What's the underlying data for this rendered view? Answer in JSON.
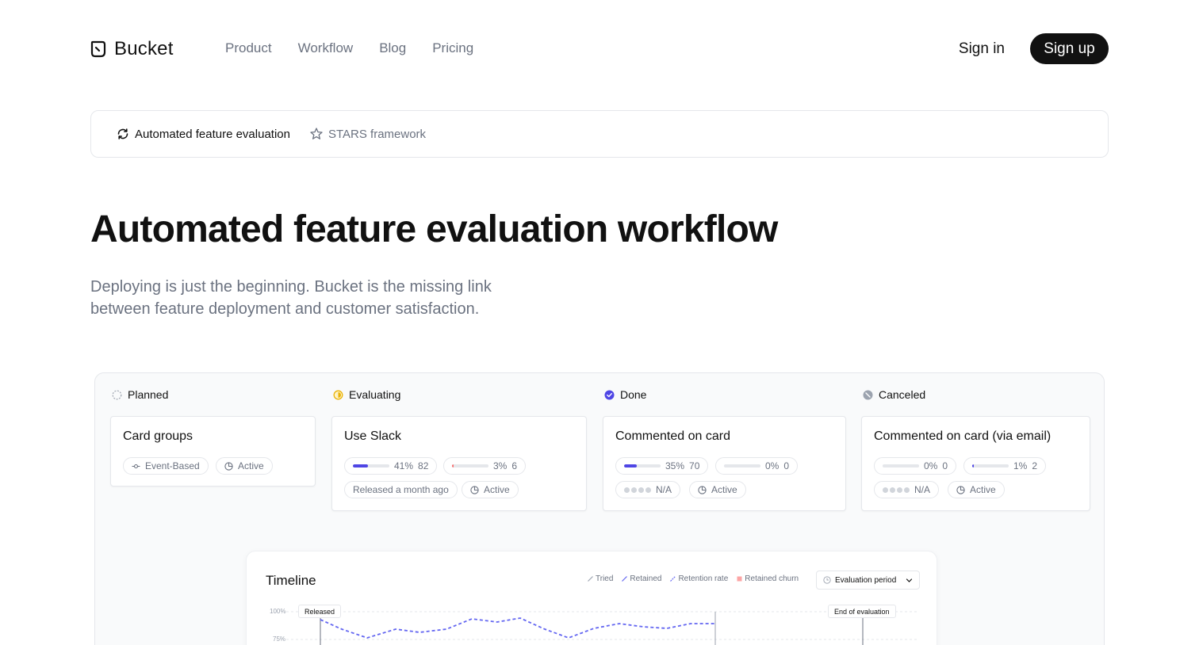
{
  "brand": {
    "name": "Bucket"
  },
  "nav": {
    "items": [
      "Product",
      "Workflow",
      "Blog",
      "Pricing"
    ]
  },
  "auth": {
    "signin": "Sign in",
    "signup": "Sign up"
  },
  "tabs": [
    {
      "label": "Automated feature evaluation",
      "icon": "refresh-icon",
      "active": true
    },
    {
      "label": "STARS framework",
      "icon": "star-icon",
      "active": false
    }
  ],
  "hero": {
    "title": "Automated feature evaluation workflow",
    "subtitle_line1": "Deploying is just the beginning. Bucket is the missing link",
    "subtitle_line2": "between feature deployment and customer satisfaction."
  },
  "board": {
    "columns": [
      {
        "label": "Planned",
        "icon": "dashed-circle-icon"
      },
      {
        "label": "Evaluating",
        "icon": "half-circle-icon",
        "color": "#eab308"
      },
      {
        "label": "Done",
        "icon": "check-circle-icon",
        "color": "#4f46e5"
      },
      {
        "label": "Canceled",
        "icon": "slash-circle-icon",
        "color": "#9ca3af"
      }
    ],
    "cards": {
      "card_groups": {
        "title": "Card groups",
        "type": "Event-Based",
        "status": "Active"
      },
      "use_slack": {
        "title": "Use Slack",
        "m1_pct": "41%",
        "m1_count": "82",
        "m1_fill": 0.41,
        "m2_pct": "3%",
        "m2_count": "6",
        "m2_fill": 0.03,
        "released": "Released a month ago",
        "status": "Active"
      },
      "commented": {
        "title": "Commented on card",
        "m1_pct": "35%",
        "m1_count": "70",
        "m1_fill": 0.35,
        "m2_pct": "0%",
        "m2_count": "0",
        "m2_fill": 0,
        "score": "N/A",
        "status": "Active"
      },
      "commented_email": {
        "title": "Commented on card (via email)",
        "m1_pct": "0%",
        "m1_count": "0",
        "m1_fill": 0,
        "m2_pct": "1%",
        "m2_count": "2",
        "m2_fill": 0.01,
        "score": "N/A",
        "status": "Active"
      }
    }
  },
  "timeline": {
    "title": "Timeline",
    "legend": [
      "Tried",
      "Retained",
      "Retention rate",
      "Retained churn"
    ],
    "select": "Evaluation period",
    "y_labels": [
      "100%",
      "75%"
    ],
    "markers": {
      "released": "Released",
      "end": "End of evaluation"
    }
  },
  "colors": {
    "accent": "#4f46e5",
    "text": "#111111",
    "muted": "#6b7280",
    "border": "#e5e7eb"
  }
}
